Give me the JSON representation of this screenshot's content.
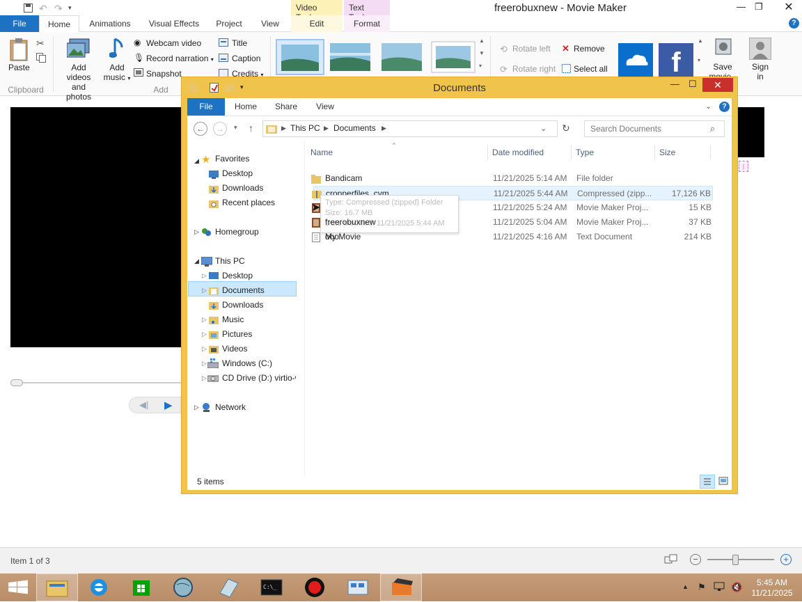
{
  "mm": {
    "title": "freerobuxnew - Movie Maker",
    "ctx_video": "Video Tools",
    "ctx_text": "Text Tools",
    "tabs": [
      "File",
      "Home",
      "Animations",
      "Visual Effects",
      "Project",
      "View",
      "Edit",
      "Format"
    ],
    "ribbon": {
      "paste": "Paste",
      "clipboard": "Clipboard",
      "add_videos_1": "Add videos",
      "add_videos_2": "and photos",
      "add_music_1": "Add",
      "add_music_2": "music",
      "add_group": "Add",
      "webcam": "Webcam video",
      "narration": "Record narration",
      "snapshot": "Snapshot",
      "title": "Title",
      "caption": "Caption",
      "credits": "Credits",
      "rotate_left": "Rotate left",
      "rotate_right": "Rotate right",
      "remove": "Remove",
      "select_all": "Select all",
      "save_movie_1": "Save",
      "save_movie_2": "movie",
      "sign_in_1": "Sign",
      "sign_in_2": "in"
    },
    "status": "Item 1 of 3"
  },
  "explorer": {
    "title": "Documents",
    "tabs": [
      "File",
      "Home",
      "Share",
      "View"
    ],
    "breadcrumb": [
      "This PC",
      "Documents"
    ],
    "search_placeholder": "Search Documents",
    "columns": [
      "Name",
      "Date modified",
      "Type",
      "Size"
    ],
    "nav": {
      "favorites": "Favorites",
      "fav_items": [
        "Desktop",
        "Downloads",
        "Recent places"
      ],
      "homegroup": "Homegroup",
      "this_pc": "This PC",
      "pc_items": [
        "Desktop",
        "Documents",
        "Downloads",
        "Music",
        "Pictures",
        "Videos",
        "Windows (C:)",
        "CD Drive (D:) virtio-w"
      ],
      "network": "Network"
    },
    "files": [
      {
        "name": "Bandicam",
        "date": "11/21/2025 5:14 AM",
        "type": "File folder",
        "size": ""
      },
      {
        "name": "cropperfiles_cvm",
        "date": "11/21/2025 5:44 AM",
        "type": "Compressed (zipp...",
        "size": "17,126 KB"
      },
      {
        "name": "freerobuxnew",
        "date": "11/21/2025 5:24 AM",
        "type": "Movie Maker Proj...",
        "size": "15 KB"
      },
      {
        "name": "My Movie",
        "date": "11/21/2025 5:04 AM",
        "type": "Movie Maker Proj...",
        "size": "37 KB"
      },
      {
        "name": "ooo",
        "date": "11/21/2025 4:16 AM",
        "type": "Text Document",
        "size": "214 KB"
      }
    ],
    "tooltip": {
      "line1": "Type: Compressed (zipped) Folder",
      "line2": "Size: 16.7 MB",
      "line3": "Date modified: 11/21/2025 5:44 AM"
    },
    "status": "5 items"
  },
  "taskbar": {
    "time": "5:45 AM",
    "date": "11/21/2025"
  },
  "colors": {
    "explorer_frame": "#f0c34a",
    "file_tab": "#1e72c4",
    "selection": "#cce8ff",
    "taskbar": "#b98d67"
  }
}
